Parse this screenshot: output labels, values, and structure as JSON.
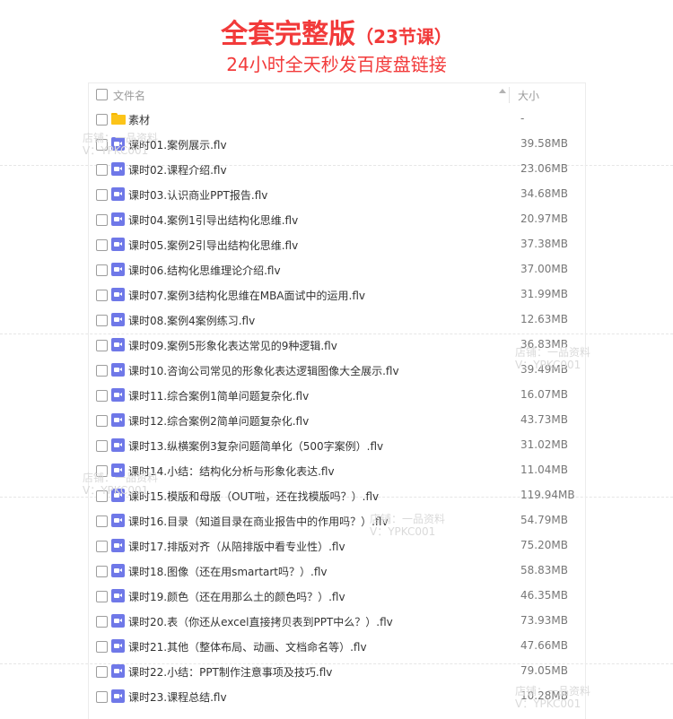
{
  "header": {
    "title_main": "全套完整版",
    "title_count": "（23节课）",
    "subtitle": "24小时全天秒发百度盘链接"
  },
  "table": {
    "col_name": "文件名",
    "col_size": "大小",
    "rows": [
      {
        "type": "folder",
        "name": "素材",
        "size": "-"
      },
      {
        "type": "video",
        "name": "课时01.案例展示.flv",
        "size": "39.58MB"
      },
      {
        "type": "video",
        "name": "课时02.课程介绍.flv",
        "size": "23.06MB"
      },
      {
        "type": "video",
        "name": "课时03.认识商业PPT报告.flv",
        "size": "34.68MB"
      },
      {
        "type": "video",
        "name": "课时04.案例1引导出结构化思维.flv",
        "size": "20.97MB"
      },
      {
        "type": "video",
        "name": "课时05.案例2引导出结构化思维.flv",
        "size": "37.38MB"
      },
      {
        "type": "video",
        "name": "课时06.结构化思维理论介绍.flv",
        "size": "37.00MB"
      },
      {
        "type": "video",
        "name": "课时07.案例3结构化思维在MBA面试中的运用.flv",
        "size": "31.99MB"
      },
      {
        "type": "video",
        "name": "课时08.案例4案例练习.flv",
        "size": "12.63MB"
      },
      {
        "type": "video",
        "name": "课时09.案例5形象化表达常见的9种逻辑.flv",
        "size": "36.83MB"
      },
      {
        "type": "video",
        "name": "课时10.咨询公司常见的形象化表达逻辑图像大全展示.flv",
        "size": "39.49MB"
      },
      {
        "type": "video",
        "name": "课时11.综合案例1简单问题复杂化.flv",
        "size": "16.07MB"
      },
      {
        "type": "video",
        "name": "课时12.综合案例2简单问题复杂化.flv",
        "size": "43.73MB"
      },
      {
        "type": "video",
        "name": "课时13.纵横案例3复杂问题简单化（500字案例）.flv",
        "size": "31.02MB"
      },
      {
        "type": "video",
        "name": "课时14.小结：结构化分析与形象化表达.flv",
        "size": "11.04MB"
      },
      {
        "type": "video",
        "name": "课时15.模版和母版（OUT啦，还在找模版吗？）.flv",
        "size": "119.94MB"
      },
      {
        "type": "video",
        "name": "课时16.目录（知道目录在商业报告中的作用吗？）.flv",
        "size": "54.79MB"
      },
      {
        "type": "video",
        "name": "课时17.排版对齐（从陪排版中看专业性）.flv",
        "size": "75.20MB"
      },
      {
        "type": "video",
        "name": "课时18.图像（还在用smartart吗？）.flv",
        "size": "58.83MB"
      },
      {
        "type": "video",
        "name": "课时19.颜色（还在用那么土的颜色吗？）.flv",
        "size": "46.35MB"
      },
      {
        "type": "video",
        "name": "课时20.表（你还从excel直接拷贝表到PPT中么？）.flv",
        "size": "73.93MB"
      },
      {
        "type": "video",
        "name": "课时21.其他（整体布局、动画、文档命名等）.flv",
        "size": "47.66MB"
      },
      {
        "type": "video",
        "name": "课时22.小结：PPT制作注意事项及技巧.flv",
        "size": "79.05MB"
      },
      {
        "type": "video",
        "name": "课时23.课程总结.flv",
        "size": "10.28MB"
      }
    ]
  },
  "watermark": {
    "line1": "店铺：一品资料",
    "line2": "V：YPKC001"
  },
  "colors": {
    "title": "#f23a3a",
    "video_icon": "#6f78e8",
    "folder_icon": "#fcc419"
  }
}
